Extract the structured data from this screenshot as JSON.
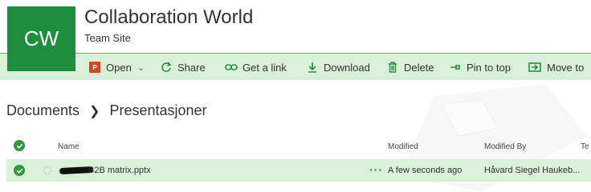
{
  "site": {
    "logo_text": "CW",
    "title": "Collaboration World",
    "subtitle": "Team Site"
  },
  "commands": {
    "open": "Open",
    "share": "Share",
    "get_link": "Get a link",
    "download": "Download",
    "delete": "Delete",
    "pin_to_top": "Pin to top",
    "move_to": "Move to"
  },
  "breadcrumb": {
    "root": "Documents",
    "current": "Presentasjoner"
  },
  "list": {
    "columns": {
      "name": "Name",
      "modified": "Modified",
      "modified_by": "Modified By",
      "extra": "Te"
    },
    "rows": [
      {
        "name": "B2B matrix.pptx",
        "modified": "A few seconds ago",
        "modified_by": "Håvard Siegel Haukeb..."
      }
    ]
  },
  "colors": {
    "brand": "#1e8e3e",
    "command_bar_bg": "#d8efd8",
    "accent_icon": "#2e8b3d"
  }
}
